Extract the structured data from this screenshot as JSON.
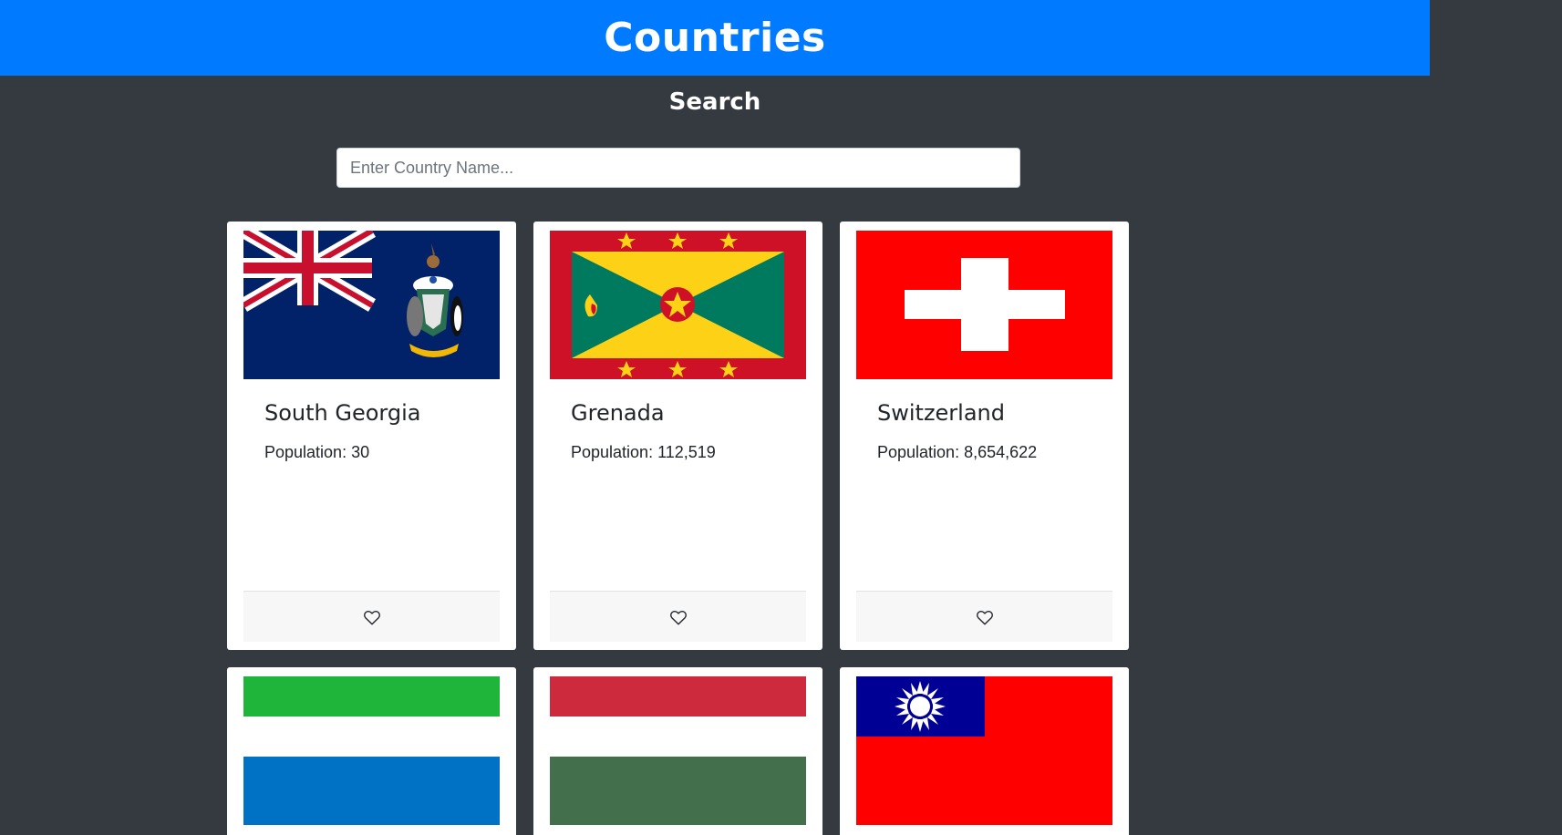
{
  "header": {
    "title": "Countries"
  },
  "search": {
    "title": "Search",
    "placeholder": "Enter Country Name..."
  },
  "countries": [
    {
      "name": "South Georgia",
      "population_label": "Population: 30",
      "flag": "south-georgia-flag"
    },
    {
      "name": "Grenada",
      "population_label": "Population: 112,519",
      "flag": "grenada-flag"
    },
    {
      "name": "Switzerland",
      "population_label": "Population: 8,654,622",
      "flag": "switzerland-flag"
    },
    {
      "flag": "sierra-leone-flag"
    },
    {
      "flag": "hungary-flag"
    },
    {
      "flag": "taiwan-flag"
    }
  ],
  "colors": {
    "header_bg": "#007bff",
    "page_bg": "#343a40",
    "card_bg": "#ffffff"
  },
  "icons": {
    "favorite": "heart-outline-icon"
  }
}
